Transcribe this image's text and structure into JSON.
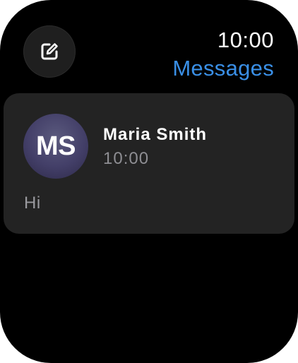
{
  "status_bar": {
    "time": "10:00"
  },
  "header": {
    "title": "Messages",
    "title_color": "#3a8fe6",
    "compose_icon": "compose-icon"
  },
  "conversations": [
    {
      "avatar_initials": "MS",
      "name": "Maria Smith",
      "time": "10:00",
      "preview": "Hi"
    }
  ]
}
